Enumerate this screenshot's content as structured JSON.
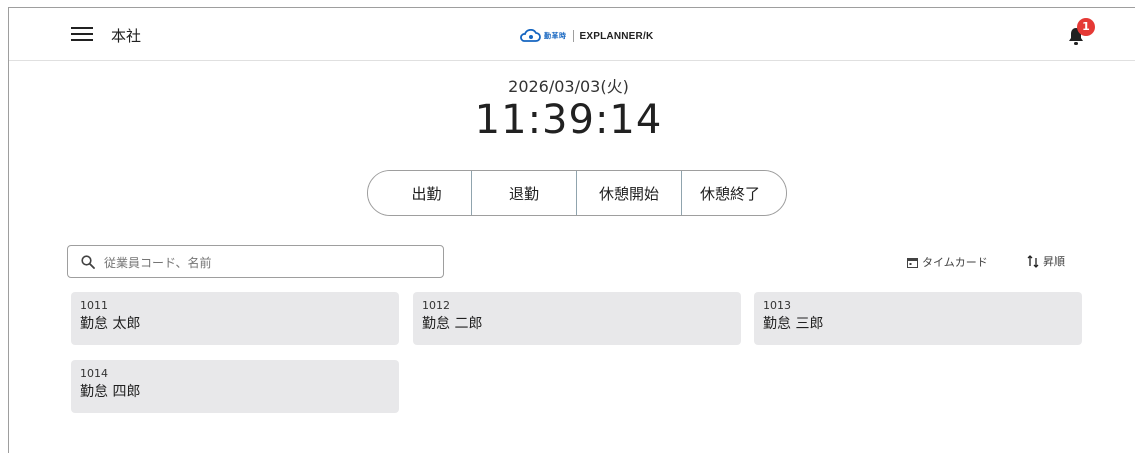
{
  "header": {
    "office": "本社",
    "brand_jp": "勤革時",
    "brand_en": "EXPLANNER/K",
    "notification_count": "1"
  },
  "clock": {
    "date": "2026/03/03(火)",
    "time": "11:39:14"
  },
  "punch_buttons": [
    "出勤",
    "退勤",
    "休憩開始",
    "休憩終了"
  ],
  "search": {
    "placeholder": "従業員コード、名前",
    "value": ""
  },
  "actions": {
    "timecard": "タイムカード",
    "sort": "昇順"
  },
  "employees": [
    {
      "code": "1011",
      "name": "勤怠 太郎"
    },
    {
      "code": "1012",
      "name": "勤怠 二郎"
    },
    {
      "code": "1013",
      "name": "勤怠 三郎"
    },
    {
      "code": "1014",
      "name": "勤怠 四郎"
    }
  ],
  "colors": {
    "brand_blue": "#1565c0",
    "badge_red": "#e53935",
    "card_bg": "#e8e8ea"
  },
  "icons": [
    "menu-icon",
    "cloud-logo-icon",
    "bell-icon",
    "search-icon",
    "calendar-icon",
    "sort-icon"
  ]
}
